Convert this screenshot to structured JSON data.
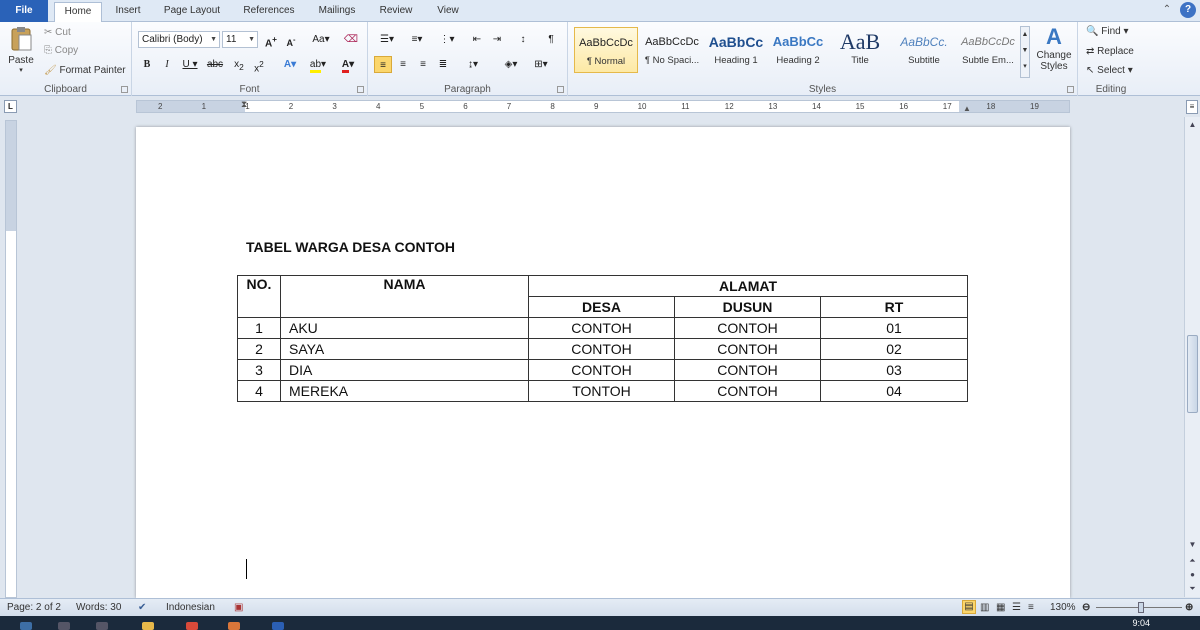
{
  "tabs": {
    "file": "File",
    "home": "Home",
    "insert": "Insert",
    "page_layout": "Page Layout",
    "references": "References",
    "mailings": "Mailings",
    "review": "Review",
    "view": "View"
  },
  "clipboard": {
    "label": "Clipboard",
    "paste": "Paste",
    "cut": "Cut",
    "copy": "Copy",
    "format_painter": "Format Painter"
  },
  "font": {
    "label": "Font",
    "family": "Calibri (Body)",
    "size": "11"
  },
  "paragraph": {
    "label": "Paragraph"
  },
  "styles": {
    "label": "Styles",
    "items": [
      {
        "sample": "AaBbCcDc",
        "name": "¶ Normal"
      },
      {
        "sample": "AaBbCcDc",
        "name": "¶ No Spaci..."
      },
      {
        "sample": "AaBbCc",
        "name": "Heading 1"
      },
      {
        "sample": "AaBbCc",
        "name": "Heading 2"
      },
      {
        "sample": "AaB",
        "name": "Title"
      },
      {
        "sample": "AaBbCc.",
        "name": "Subtitle"
      },
      {
        "sample": "AaBbCcDc",
        "name": "Subtle Em..."
      }
    ],
    "change_styles": "Change Styles"
  },
  "editing": {
    "label": "Editing",
    "find": "Find",
    "replace": "Replace",
    "select": "Select"
  },
  "ruler": {
    "ticks": [
      "2",
      "1",
      "1",
      "2",
      "3",
      "4",
      "5",
      "6",
      "7",
      "8",
      "9",
      "10",
      "11",
      "12",
      "13",
      "14",
      "15",
      "16",
      "17",
      "18",
      "19"
    ]
  },
  "document": {
    "title": "TABEL WARGA DESA CONTOH",
    "headers": {
      "no": "NO.",
      "nama": "NAMA",
      "alamat": "ALAMAT",
      "desa": "DESA",
      "dusun": "DUSUN",
      "rt": "RT"
    },
    "rows": [
      {
        "no": "1",
        "nama": "AKU",
        "desa": "CONTOH",
        "dusun": "CONTOH",
        "rt": "01"
      },
      {
        "no": "2",
        "nama": "SAYA",
        "desa": "CONTOH",
        "dusun": "CONTOH",
        "rt": "02"
      },
      {
        "no": "3",
        "nama": "DIA",
        "desa": "CONTOH",
        "dusun": "CONTOH",
        "rt": "03"
      },
      {
        "no": "4",
        "nama": "MEREKA",
        "desa": "TONTOH",
        "dusun": "CONTOH",
        "rt": "04"
      }
    ]
  },
  "status": {
    "page": "Page: 2 of 2",
    "words": "Words: 30",
    "language": "Indonesian",
    "zoom": "130%"
  },
  "taskbar": {
    "time": "9:04"
  }
}
